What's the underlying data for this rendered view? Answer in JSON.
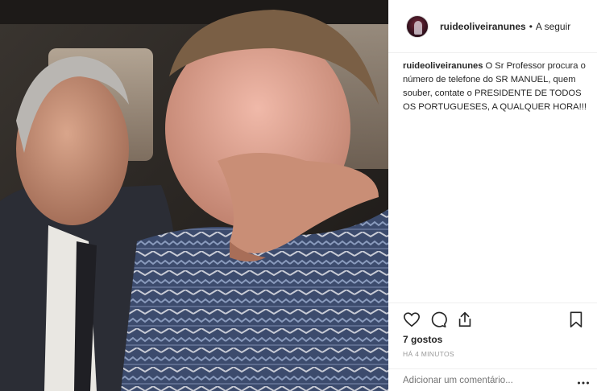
{
  "post": {
    "username": "ruideoliveiranunes",
    "separator": "•",
    "follow_label": "A seguir",
    "caption_user": "ruideoliveiranunes",
    "caption_text": "O Sr Professor procura o número de telefone do SR MANUEL, quem souber, contate o PRESIDENTE DE TODOS OS PORTUGUESES, A QUALQUER HORA!!!",
    "likes": "7 gostos",
    "timestamp": "HÁ 4 MINUTOS",
    "comment_placeholder": "Adicionar um comentário..."
  },
  "icons": {
    "like": "heart-icon",
    "comment": "comment-bubble-icon",
    "share": "share-upload-icon",
    "save": "bookmark-icon",
    "more": "more-options-icon"
  },
  "colors": {
    "text": "#262626",
    "muted": "#999999",
    "border": "#efefef"
  }
}
